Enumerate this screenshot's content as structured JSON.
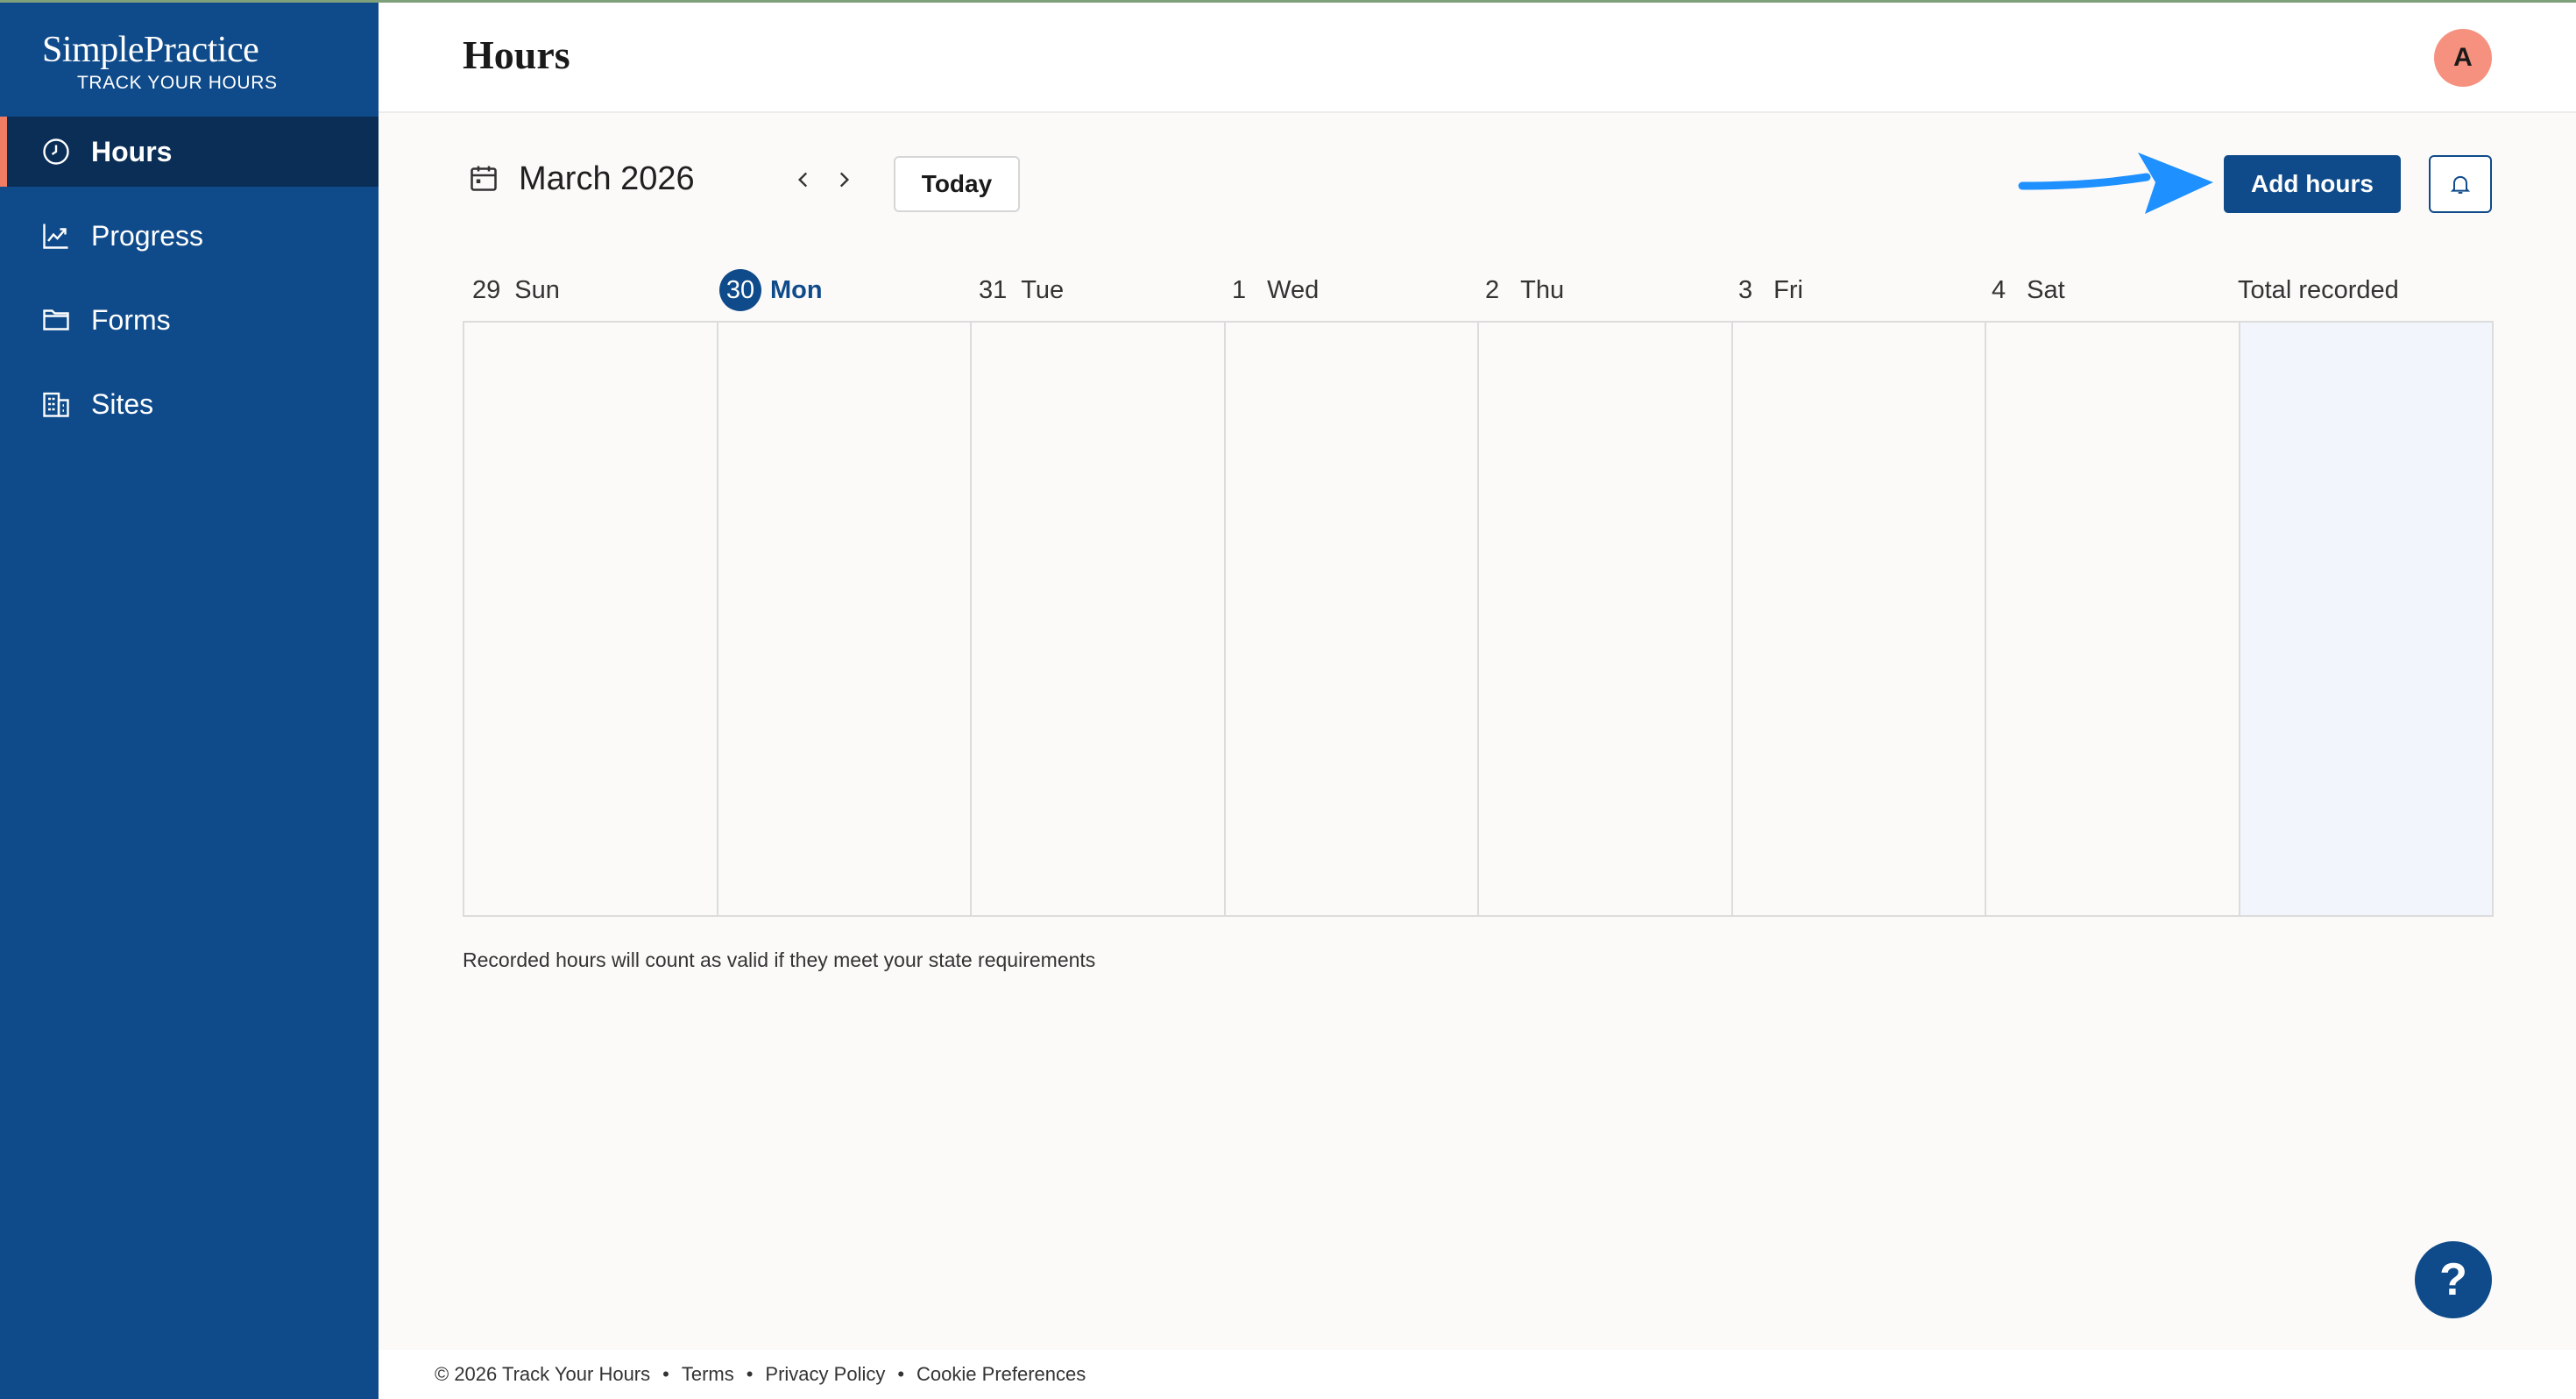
{
  "brand": {
    "name": "SimplePractice",
    "subtitle": "TRACK YOUR HOURS"
  },
  "sidebar": {
    "items": [
      {
        "label": "Hours",
        "icon": "clock-icon",
        "active": true
      },
      {
        "label": "Progress",
        "icon": "chart-line-icon",
        "active": false
      },
      {
        "label": "Forms",
        "icon": "folder-icon",
        "active": false
      },
      {
        "label": "Sites",
        "icon": "building-icon",
        "active": false
      }
    ]
  },
  "header": {
    "title": "Hours",
    "avatar_initial": "A"
  },
  "toolbar": {
    "month": "March 2026",
    "today_label": "Today",
    "add_hours_label": "Add hours"
  },
  "calendar": {
    "days": [
      {
        "num": "29",
        "name": "Sun"
      },
      {
        "num": "30",
        "name": "Mon",
        "today": true
      },
      {
        "num": "31",
        "name": "Tue"
      },
      {
        "num": "1",
        "name": "Wed"
      },
      {
        "num": "2",
        "name": "Thu"
      },
      {
        "num": "3",
        "name": "Fri"
      },
      {
        "num": "4",
        "name": "Sat"
      }
    ],
    "total_label": "Total recorded"
  },
  "note": "Recorded hours will count as valid if they meet your state requirements",
  "help_label": "?",
  "footer": {
    "copyright": "© 2026 Track Your Hours",
    "separator": "•",
    "links": [
      "Terms",
      "Privacy Policy",
      "Cookie Preferences"
    ]
  },
  "colors": {
    "sidebar": "#0f4b8a",
    "sidebar_active": "#0a2e55",
    "accent": "#f07c64",
    "primary_button": "#0f4b8a",
    "annotation_arrow": "#1e90ff"
  }
}
